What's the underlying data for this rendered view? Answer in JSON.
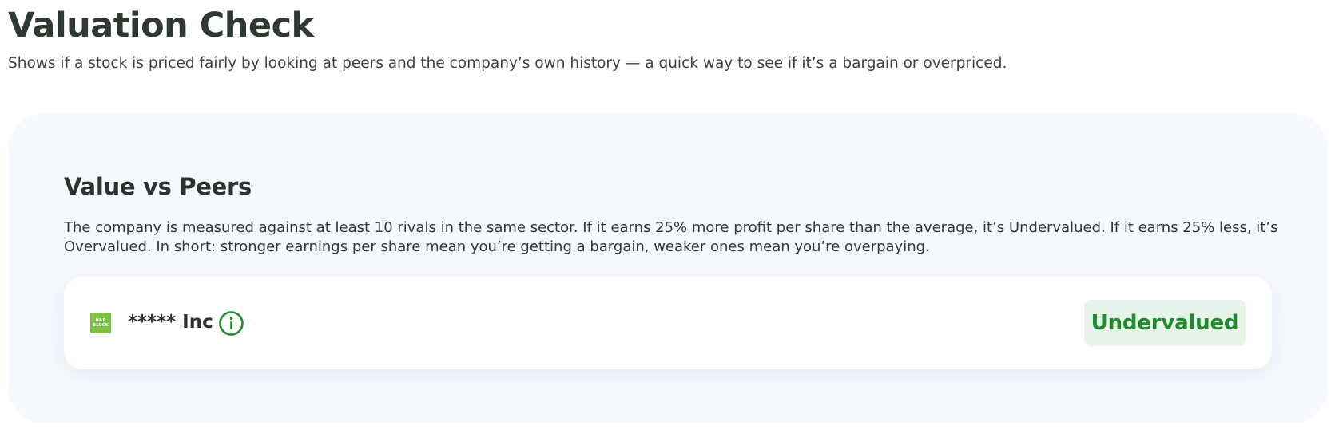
{
  "header": {
    "title": "Valuation Check",
    "subtitle": "Shows if a stock is priced fairly by looking at peers and the company’s own history — a quick way to see if it’s a bargain or overpriced."
  },
  "section": {
    "title": "Value vs Peers",
    "description": "The company is measured against at least 10 rivals in the same sector. If it earns 25% more profit per share than the average, it’s Undervalued. If it earns 25% less, it’s Overvalued. In short: stronger earnings per share mean you’re getting a bargain, weaker ones mean you’re overpaying."
  },
  "company": {
    "name": "***** Inc",
    "logo_lines": [
      "H&R",
      "BLOCK"
    ],
    "info_icon": "info-circle-icon",
    "valuation_status": "Undervalued"
  },
  "colors": {
    "status_text": "#1f8a2e",
    "status_background": "#e6f4e9",
    "logo_background": "#79c043",
    "panel_background": "#f5f8fc"
  }
}
